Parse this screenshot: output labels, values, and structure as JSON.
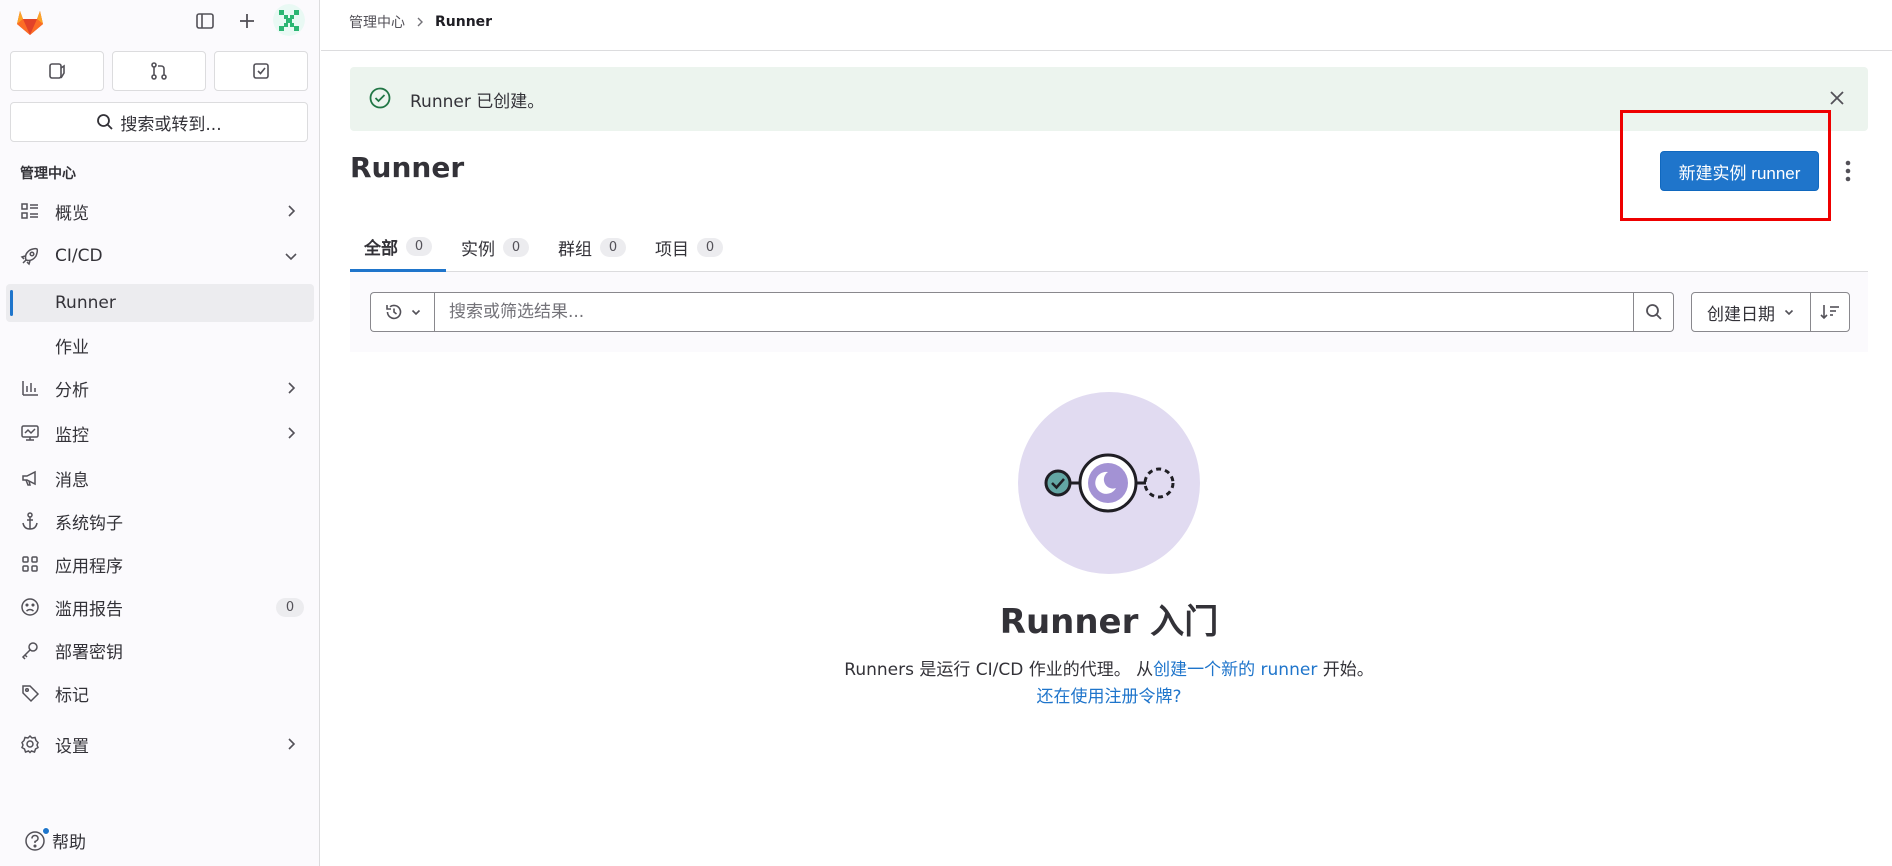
{
  "sidebar": {
    "search_label": "搜索或转到...",
    "section_title": "管理中心",
    "items": [
      {
        "label": "概览",
        "icon": "overview-icon"
      },
      {
        "label": "CI/CD",
        "icon": "rocket-icon"
      },
      {
        "label": "Runner"
      },
      {
        "label": "作业"
      },
      {
        "label": "分析",
        "icon": "chart-icon"
      },
      {
        "label": "监控",
        "icon": "monitor-icon"
      },
      {
        "label": "消息",
        "icon": "bullhorn-icon"
      },
      {
        "label": "系统钩子",
        "icon": "anchor-icon"
      },
      {
        "label": "应用程序",
        "icon": "grid-icon"
      },
      {
        "label": "滥用报告",
        "icon": "sad-face-icon",
        "count": "0"
      },
      {
        "label": "部署密钥",
        "icon": "key-icon"
      },
      {
        "label": "标记",
        "icon": "label-icon"
      },
      {
        "label": "设置",
        "icon": "gear-icon"
      }
    ],
    "help_label": "帮助"
  },
  "breadcrumb": {
    "parent": "管理中心",
    "current": "Runner"
  },
  "alert": {
    "text": "Runner 已创建。"
  },
  "page": {
    "title": "Runner",
    "new_button": "新建实例 runner"
  },
  "tabs": [
    {
      "label": "全部",
      "count": "0"
    },
    {
      "label": "实例",
      "count": "0"
    },
    {
      "label": "群组",
      "count": "0"
    },
    {
      "label": "项目",
      "count": "0"
    }
  ],
  "filter": {
    "placeholder": "搜索或筛选结果...",
    "sort_label": "创建日期"
  },
  "empty_state": {
    "title": "Runner 入门",
    "desc_prefix": "Runners 是运行 CI/CD 作业的代理。 从",
    "desc_link": "创建一个新的 runner",
    "desc_suffix": " 开始。",
    "token_link": "还在使用注册令牌?"
  },
  "colors": {
    "accent": "#1f75cb",
    "success_bg": "#ecf4ee",
    "highlight": "#ee0000"
  }
}
